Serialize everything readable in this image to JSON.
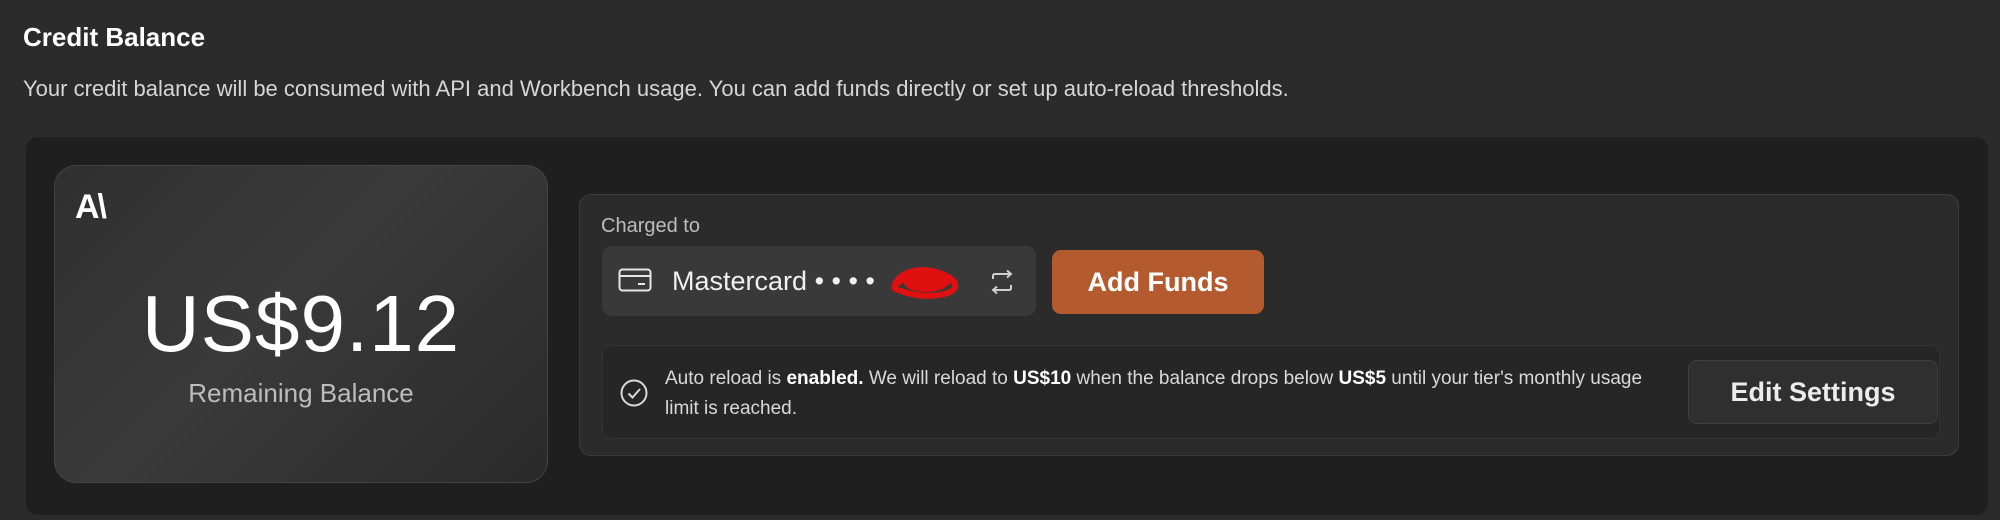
{
  "header": {
    "title": "Credit Balance",
    "description": "Your credit balance will be consumed with API and Workbench usage. You can add funds directly or set up auto-reload thresholds."
  },
  "balance_card": {
    "logo": "A\\",
    "amount": "US$9.12",
    "label": "Remaining Balance"
  },
  "payment": {
    "charged_to_label": "Charged to",
    "card_brand": "Mastercard",
    "card_mask": "• • • •",
    "card_icon": "credit-card-icon",
    "switch_icon": "swap-icon",
    "add_funds_label": "Add Funds"
  },
  "auto_reload": {
    "status_icon": "check-circle-icon",
    "part1": "Auto reload is ",
    "status": "enabled.",
    "part2": " We will reload to ",
    "reload_amount": "US$10",
    "part3": " when the balance drops below ",
    "threshold": "US$5",
    "part4": " until your tier's monthly usage limit is reached.",
    "edit_label": "Edit Settings"
  },
  "colors": {
    "accent": "#b35a2f",
    "background": "#2b2b2b",
    "panel": "#1f1f1f",
    "redaction": "#e01010"
  }
}
